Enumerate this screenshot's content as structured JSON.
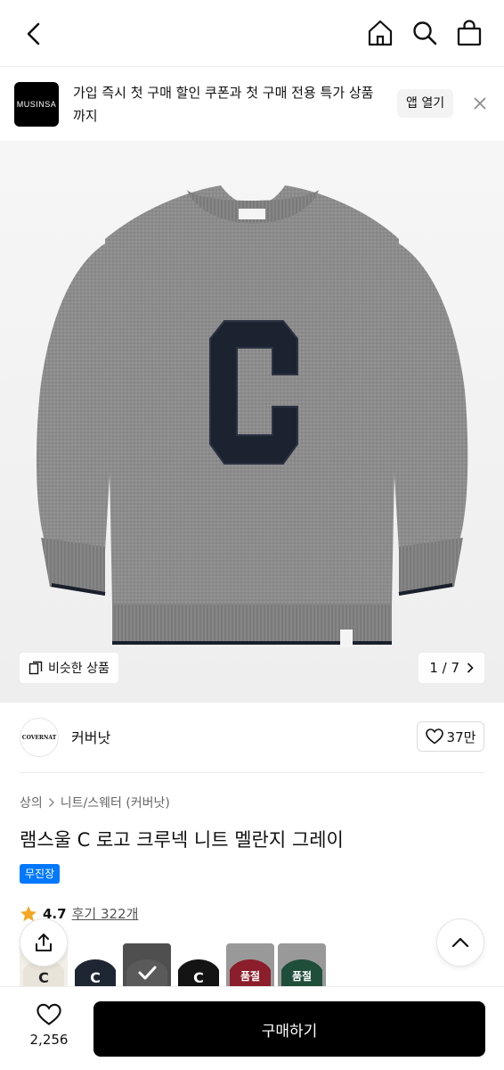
{
  "nav": {
    "icons": [
      "back-icon",
      "home-icon",
      "search-icon",
      "shopping-bag-icon"
    ]
  },
  "promo": {
    "logo_text": "MUSINSA",
    "message": "가입 즉시 첫 구매 할인 쿠폰과 첫 구매 전용 특가 상품까지",
    "open_app_label": "앱 열기"
  },
  "hero": {
    "similar_label": "비슷한 상품",
    "pager_text": "1 / 7"
  },
  "brand": {
    "logo_text": "COVERNAT",
    "name": "커버낫",
    "likes": "37만"
  },
  "product": {
    "breadcrumb": [
      "상의",
      "니트/스웨터 (커버낫)"
    ],
    "title": "램스울 C 로고 크루넥 니트 멜란지 그레이",
    "badge": "무진장",
    "rating": "4.7",
    "reviews": "후기 322개"
  },
  "swatches": [
    {
      "color": "#eeeae2",
      "letter": "C",
      "label": ""
    },
    {
      "color": "#1f2633",
      "letter": "C",
      "label": ""
    },
    {
      "color": "#8a8a8a",
      "letter": "",
      "label": "",
      "selected": true
    },
    {
      "color": "#141414",
      "letter": "C",
      "label": ""
    },
    {
      "color": "#8b1e2a",
      "letter": "",
      "label": "품절"
    },
    {
      "color": "#1f4e3a",
      "letter": "",
      "label": "품절"
    }
  ],
  "bottom": {
    "wish_count": "2,256",
    "buy_label": "구매하기"
  },
  "colors": {
    "badge_blue": "#0078ff",
    "buy_button": "#000000",
    "rating_star": "#f5a623"
  }
}
